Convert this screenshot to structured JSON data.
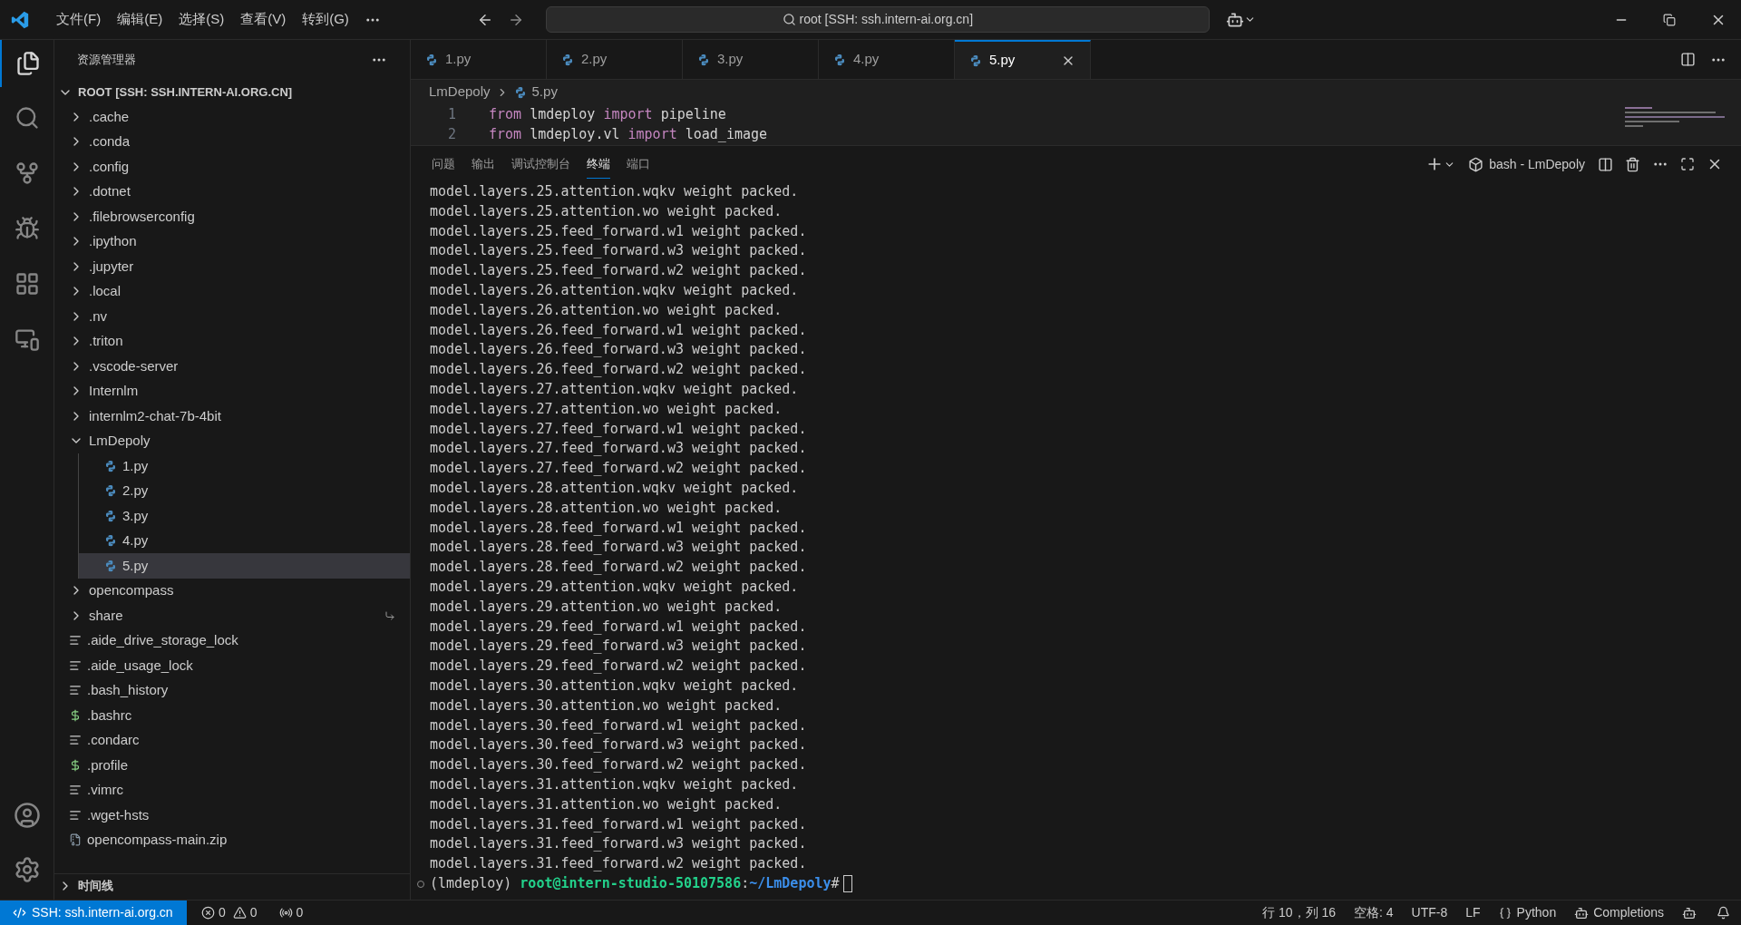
{
  "title_bar": {
    "menus": [
      "文件(F)",
      "编辑(E)",
      "选择(S)",
      "查看(V)",
      "转到(G)"
    ],
    "command_center": "root [SSH: ssh.intern-ai.org.cn]"
  },
  "sidebar": {
    "title": "资源管理器",
    "root": {
      "label": "ROOT [SSH: SSH.INTERN-AI.ORG.CN]",
      "expanded": true
    },
    "items": [
      {
        "label": ".cache",
        "kind": "folder",
        "expanded": false,
        "selected": false
      },
      {
        "label": ".conda",
        "kind": "folder",
        "expanded": false,
        "selected": false
      },
      {
        "label": ".config",
        "kind": "folder",
        "expanded": false,
        "selected": false
      },
      {
        "label": ".dotnet",
        "kind": "folder",
        "expanded": false,
        "selected": false
      },
      {
        "label": ".filebrowserconfig",
        "kind": "folder",
        "expanded": false,
        "selected": false
      },
      {
        "label": ".ipython",
        "kind": "folder",
        "expanded": false,
        "selected": false
      },
      {
        "label": ".jupyter",
        "kind": "folder",
        "expanded": false,
        "selected": false
      },
      {
        "label": ".local",
        "kind": "folder",
        "expanded": false,
        "selected": false
      },
      {
        "label": ".nv",
        "kind": "folder",
        "expanded": false,
        "selected": false
      },
      {
        "label": ".triton",
        "kind": "folder",
        "expanded": false,
        "selected": false
      },
      {
        "label": ".vscode-server",
        "kind": "folder",
        "expanded": false,
        "selected": false
      },
      {
        "label": "Internlm",
        "kind": "folder",
        "expanded": false,
        "selected": false
      },
      {
        "label": "internlm2-chat-7b-4bit",
        "kind": "folder",
        "expanded": false,
        "selected": false
      },
      {
        "label": "LmDepoly",
        "kind": "folder",
        "expanded": true,
        "selected": false,
        "children": [
          {
            "label": "1.py",
            "kind": "python",
            "selected": false
          },
          {
            "label": "2.py",
            "kind": "python",
            "selected": false
          },
          {
            "label": "3.py",
            "kind": "python",
            "selected": false
          },
          {
            "label": "4.py",
            "kind": "python",
            "selected": false
          },
          {
            "label": "5.py",
            "kind": "python",
            "selected": true
          }
        ]
      },
      {
        "label": "opencompass",
        "kind": "folder",
        "expanded": false,
        "selected": false
      },
      {
        "label": "share",
        "kind": "folder",
        "expanded": false,
        "selected": false,
        "symlink": true
      },
      {
        "label": ".aide_drive_storage_lock",
        "kind": "text",
        "selected": false
      },
      {
        "label": ".aide_usage_lock",
        "kind": "text",
        "selected": false
      },
      {
        "label": ".bash_history",
        "kind": "text",
        "selected": false
      },
      {
        "label": ".bashrc",
        "kind": "shell",
        "selected": false
      },
      {
        "label": ".condarc",
        "kind": "text",
        "selected": false
      },
      {
        "label": ".profile",
        "kind": "shell",
        "selected": false
      },
      {
        "label": ".vimrc",
        "kind": "text",
        "selected": false
      },
      {
        "label": ".wget-hsts",
        "kind": "text",
        "selected": false
      },
      {
        "label": "opencompass-main.zip",
        "kind": "archive",
        "selected": false
      }
    ],
    "timeline": {
      "label": "时间线",
      "expanded": false
    }
  },
  "tabs": [
    {
      "label": "1.py",
      "selected": false
    },
    {
      "label": "2.py",
      "selected": false
    },
    {
      "label": "3.py",
      "selected": false
    },
    {
      "label": "4.py",
      "selected": false
    },
    {
      "label": "5.py",
      "selected": true
    }
  ],
  "breadcrumb": [
    "LmDepoly",
    "5.py"
  ],
  "editor": {
    "lines": [
      {
        "number": "1",
        "tokens": [
          {
            "text": "from",
            "kind": "keyword"
          },
          {
            "text": " lmdeploy ",
            "kind": "plain"
          },
          {
            "text": "import",
            "kind": "keyword"
          },
          {
            "text": " pipeline",
            "kind": "plain"
          }
        ]
      },
      {
        "number": "2",
        "tokens": [
          {
            "text": "from",
            "kind": "keyword"
          },
          {
            "text": " lmdeploy.vl ",
            "kind": "plain"
          },
          {
            "text": "import",
            "kind": "keyword"
          },
          {
            "text": " load_image",
            "kind": "plain"
          }
        ]
      }
    ]
  },
  "panel": {
    "tabs": [
      {
        "label": "问题",
        "selected": false
      },
      {
        "label": "输出",
        "selected": false
      },
      {
        "label": "调试控制台",
        "selected": false
      },
      {
        "label": "终端",
        "selected": true
      },
      {
        "label": "端口",
        "selected": false
      }
    ],
    "terminal_name": "bash - LmDepoly",
    "lines": [
      "model.layers.25.attention.wqkv weight packed.",
      "model.layers.25.attention.wo weight packed.",
      "model.layers.25.feed_forward.w1 weight packed.",
      "model.layers.25.feed_forward.w3 weight packed.",
      "model.layers.25.feed_forward.w2 weight packed.",
      "model.layers.26.attention.wqkv weight packed.",
      "model.layers.26.attention.wo weight packed.",
      "model.layers.26.feed_forward.w1 weight packed.",
      "model.layers.26.feed_forward.w3 weight packed.",
      "model.layers.26.feed_forward.w2 weight packed.",
      "model.layers.27.attention.wqkv weight packed.",
      "model.layers.27.attention.wo weight packed.",
      "model.layers.27.feed_forward.w1 weight packed.",
      "model.layers.27.feed_forward.w3 weight packed.",
      "model.layers.27.feed_forward.w2 weight packed.",
      "model.layers.28.attention.wqkv weight packed.",
      "model.layers.28.attention.wo weight packed.",
      "model.layers.28.feed_forward.w1 weight packed.",
      "model.layers.28.feed_forward.w3 weight packed.",
      "model.layers.28.feed_forward.w2 weight packed.",
      "model.layers.29.attention.wqkv weight packed.",
      "model.layers.29.attention.wo weight packed.",
      "model.layers.29.feed_forward.w1 weight packed.",
      "model.layers.29.feed_forward.w3 weight packed.",
      "model.layers.29.feed_forward.w2 weight packed.",
      "model.layers.30.attention.wqkv weight packed.",
      "model.layers.30.attention.wo weight packed.",
      "model.layers.30.feed_forward.w1 weight packed.",
      "model.layers.30.feed_forward.w3 weight packed.",
      "model.layers.30.feed_forward.w2 weight packed.",
      "model.layers.31.attention.wqkv weight packed.",
      "model.layers.31.attention.wo weight packed.",
      "model.layers.31.feed_forward.w1 weight packed.",
      "model.layers.31.feed_forward.w3 weight packed.",
      "model.layers.31.feed_forward.w2 weight packed."
    ],
    "prompt": {
      "env": "(lmdeploy)",
      "user": "root@intern-studio-50107586",
      "separator": ":",
      "path": "~/LmDepoly",
      "symbol": "#"
    }
  },
  "status_bar": {
    "remote": "SSH: ssh.intern-ai.org.cn",
    "errors": "0",
    "warnings": "0",
    "ports": "0",
    "position": "行 10，列 16",
    "indent": "空格: 4",
    "encoding": "UTF-8",
    "eol": "LF",
    "language": "Python",
    "completions": "Completions"
  }
}
